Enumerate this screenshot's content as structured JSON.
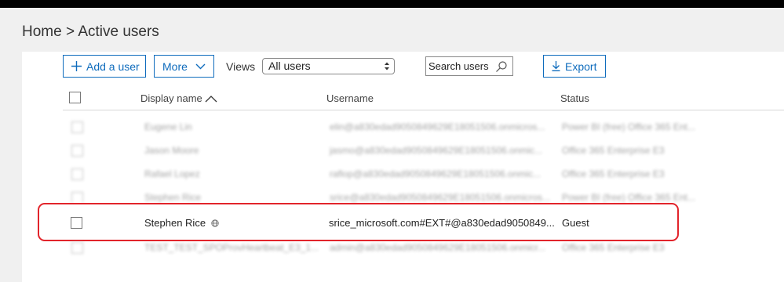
{
  "breadcrumb": {
    "home": "Home",
    "separator": ">",
    "current": "Active users"
  },
  "toolbar": {
    "add_user_label": "Add a user",
    "more_label": "More",
    "views_label": "Views",
    "views_selected": "All users",
    "search_placeholder": "Search users",
    "export_label": "Export"
  },
  "table": {
    "columns": {
      "display_name": "Display name",
      "username": "Username",
      "status": "Status"
    },
    "sort": {
      "column": "display_name",
      "direction": "ascending"
    },
    "rows": [
      {
        "display_name": "Eugene Lin",
        "username": "elin@a830edad9050849629E18051506.onmicros...",
        "status": "Power BI (free) Office 365 Ent...",
        "blurred": true
      },
      {
        "display_name": "Jason Moore",
        "username": "jasmo@a830edad9050849629E18051506.onmic...",
        "status": "Office 365 Enterprise E3",
        "blurred": true
      },
      {
        "display_name": "Rafael Lopez",
        "username": "raflop@a830edad9050849629E18051506.onmic...",
        "status": "Office 365 Enterprise E3",
        "blurred": true
      },
      {
        "display_name": "Stephen Rice",
        "username": "srice@a830edad9050849629E18051506.onmicros...",
        "status": "Power BI (free) Office 365 Ent...",
        "blurred": true
      },
      {
        "display_name": "Stephen Rice",
        "username": "srice_microsoft.com#EXT#@a830edad9050849...",
        "status": "Guest",
        "highlighted": true,
        "icon": "globe-icon"
      },
      {
        "display_name": "TEST_TEST_SPOProvHeartbeat_E3_1...",
        "username": "admin@a830edad9050849629E18051506.onmicr...",
        "status": "Office 365 Enterprise E3",
        "blurred": true
      }
    ]
  },
  "colors": {
    "accent": "#0f6cbd",
    "highlight_border": "#e2242b",
    "background": "#f0f0f0"
  }
}
